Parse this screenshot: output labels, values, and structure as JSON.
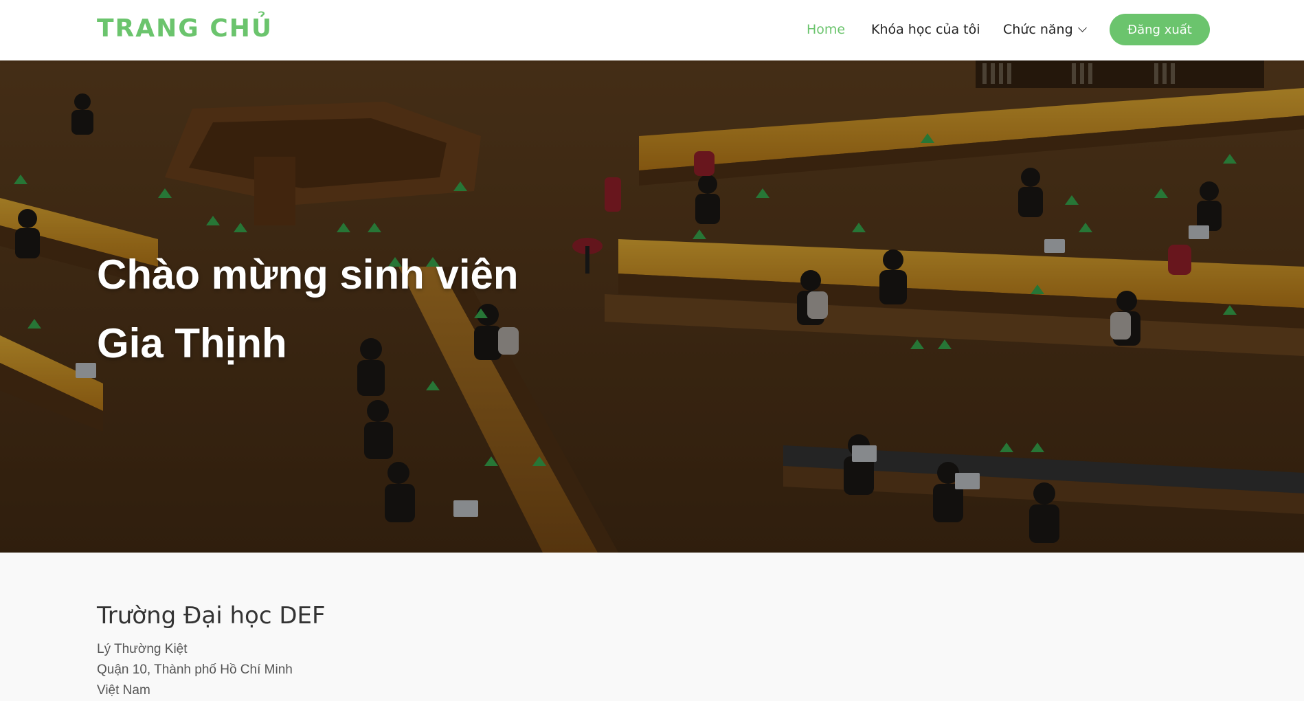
{
  "header": {
    "logo": "TRANG CHỦ",
    "nav": {
      "home": "Home",
      "my_courses": "Khóa học của tôi",
      "features": "Chức năng",
      "logout": "Đăng xuất"
    },
    "accent_color": "#6bc46d"
  },
  "hero": {
    "title_line1": "Chào mừng sinh viên",
    "title_line2": "Gia Thịnh"
  },
  "info": {
    "school_name": "Trường Đại học DEF",
    "address_line1": "Lý Thường Kiệt",
    "address_line2": "Quận 10, Thành phố Hồ Chí Minh",
    "address_line3": "Việt Nam"
  }
}
